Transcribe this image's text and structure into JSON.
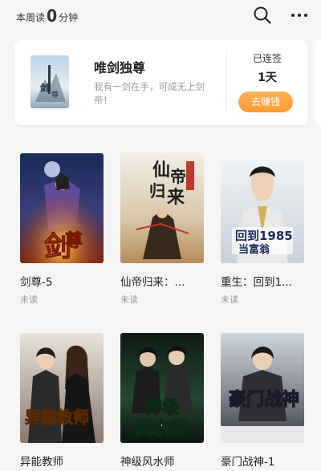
{
  "header": {
    "read_prefix": "本周读",
    "read_minutes": "0",
    "read_suffix": "分钟",
    "search_icon": "search-icon",
    "more_icon": "more-icon"
  },
  "featured": {
    "title": "唯剑独尊",
    "description": "我有一剑在手，可成无上剑帝！",
    "streak_label": "已连签",
    "streak_value": "1天",
    "earn_button": "去赚钱",
    "accent": "#ff9a2e"
  },
  "books": [
    {
      "title": "剑尊-5",
      "status": "未读"
    },
    {
      "title": "仙帝归来：...",
      "status": "未读"
    },
    {
      "title": "重生：回到1...",
      "status": "未读"
    },
    {
      "title": "异能教师",
      "status": ""
    },
    {
      "title": "神级风水师",
      "status": ""
    },
    {
      "title": "豪门战神-1",
      "status": ""
    }
  ]
}
